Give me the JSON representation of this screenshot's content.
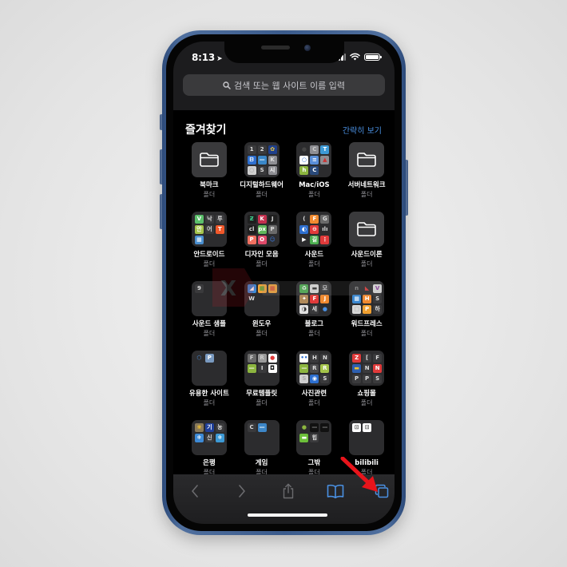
{
  "status_bar": {
    "time": "8:13",
    "location_icon": "location-arrow-icon",
    "signal_icon": "cellular-signal-icon",
    "wifi_icon": "wifi-icon",
    "battery_icon": "battery-icon",
    "battery_level": 1.0
  },
  "search": {
    "placeholder": "검색 또는 웹 사이트 이름 입력",
    "icon": "search-icon"
  },
  "favorites": {
    "title": "즐겨찾기",
    "action_label": "간략히 보기",
    "accent_color": "#4a90e2",
    "items": [
      {
        "name": "북마크",
        "sub": "폴더",
        "type": "folder"
      },
      {
        "name": "디지털하드웨어",
        "sub": "폴더",
        "type": "grid",
        "tiles": [
          {
            "t": "1",
            "bg": "#3a3a3c",
            "fg": "#ddd"
          },
          {
            "t": "2",
            "bg": "#3a3a3c",
            "fg": "#ddd"
          },
          {
            "t": "✿",
            "bg": "#1f3f8a",
            "fg": "#e9c640"
          },
          {
            "t": "ᗷ",
            "bg": "#2d6fd0",
            "fg": "#fff"
          },
          {
            "t": "—",
            "bg": "#3a87c8",
            "fg": "#fff"
          },
          {
            "t": "K",
            "bg": "#8e8e93",
            "fg": "#ddd"
          },
          {
            "t": "○",
            "bg": "#cfcfcf",
            "fg": "#999"
          },
          {
            "t": "S",
            "bg": "#3a3a3c",
            "fg": "#ddd"
          },
          {
            "t": "시",
            "bg": "#8e8e93",
            "fg": "#fff"
          }
        ]
      },
      {
        "name": "Mac/iOS",
        "sub": "폴더",
        "type": "grid",
        "tiles": [
          {
            "t": "●",
            "bg": "#2c2c2e",
            "fg": "#444"
          },
          {
            "t": "C",
            "bg": "#8e8e93",
            "fg": "#ccc"
          },
          {
            "t": "T",
            "bg": "#3d9ad6",
            "fg": "#fff"
          },
          {
            "t": "○",
            "bg": "#fff",
            "fg": "#2d6fd0"
          },
          {
            "t": "≡",
            "bg": "#5a8fd8",
            "fg": "#fff"
          },
          {
            "t": "▲",
            "bg": "#8e8e93",
            "fg": "#c33"
          },
          {
            "t": "h",
            "bg": "#8cb53f",
            "fg": "#fff"
          },
          {
            "t": "C",
            "bg": "#2a4a7a",
            "fg": "#fff"
          }
        ]
      },
      {
        "name": "서버네트워크",
        "sub": "폴더",
        "type": "folder"
      },
      {
        "name": "안드로이드",
        "sub": "폴더",
        "type": "grid",
        "tiles": [
          {
            "t": "V",
            "bg": "#5bbf6a",
            "fg": "#fff"
          },
          {
            "t": "낙",
            "bg": "#3a3a3c",
            "fg": "#ddd"
          },
          {
            "t": "루",
            "bg": "#3a3a3c",
            "fg": "#ddd"
          },
          {
            "t": "안",
            "bg": "#a4c44a",
            "fg": "#fff"
          },
          {
            "t": "어",
            "bg": "#3a3a3c",
            "fg": "#ddd"
          },
          {
            "t": "T",
            "bg": "#f0582a",
            "fg": "#fff"
          },
          {
            "t": "▦",
            "bg": "#4a8fd0",
            "fg": "#fff"
          }
        ]
      },
      {
        "name": "디자인 모음",
        "sub": "폴더",
        "type": "grid",
        "tiles": [
          {
            "t": "Ƶ",
            "bg": "#1f1f1f",
            "fg": "#3ccf8e"
          },
          {
            "t": "K",
            "bg": "#c3304e",
            "fg": "#fff"
          },
          {
            "t": "J",
            "bg": "#1f1f1f",
            "fg": "#ddd"
          },
          {
            "t": "cl",
            "bg": "#1f1f1f",
            "fg": "#ddd"
          },
          {
            "t": "px",
            "bg": "#5fb55a",
            "fg": "#fff"
          },
          {
            "t": "P",
            "bg": "#6a6a6a",
            "fg": "#ddd"
          },
          {
            "t": "P",
            "bg": "#f07060",
            "fg": "#fff"
          },
          {
            "t": "O",
            "bg": "#e04a6a",
            "fg": "#fff"
          },
          {
            "t": "☺",
            "bg": "#2c2c2e",
            "fg": "#3d7be0"
          }
        ]
      },
      {
        "name": "사운드",
        "sub": "폴더",
        "type": "grid",
        "tiles": [
          {
            "t": "(",
            "bg": "#2c2c2e",
            "fg": "#ddd"
          },
          {
            "t": "F",
            "bg": "#f08a30",
            "fg": "#fff"
          },
          {
            "t": "G",
            "bg": "#6a6a6a",
            "fg": "#ddd"
          },
          {
            "t": "◐",
            "bg": "#2d6fd0",
            "fg": "#fff"
          },
          {
            "t": "⊖",
            "bg": "#e03a3a",
            "fg": "#fff"
          },
          {
            "t": "ılı",
            "bg": "#2c2c2e",
            "fg": "#ddd"
          },
          {
            "t": "▶",
            "bg": "#2c2c2e",
            "fg": "#fff"
          },
          {
            "t": "길",
            "bg": "#4caf50",
            "fg": "#fff"
          },
          {
            "t": "⋮",
            "bg": "#e03a3a",
            "fg": "#fff"
          }
        ]
      },
      {
        "name": "사운드이론",
        "sub": "폴더",
        "type": "folder"
      },
      {
        "name": "사운드 샘플",
        "sub": "폴더",
        "type": "grid",
        "tiles": [
          {
            "t": "9",
            "bg": "#3a3a3c",
            "fg": "#ddd"
          }
        ]
      },
      {
        "name": "윈도우",
        "sub": "폴더",
        "type": "grid",
        "tiles": [
          {
            "t": "◢",
            "bg": "#3d8ad6",
            "fg": "#fff"
          },
          {
            "t": "▦",
            "bg": "#f2a33a",
            "fg": "#2d9a3a"
          },
          {
            "t": "▦",
            "bg": "#f2a33a",
            "fg": "#d03a3a"
          },
          {
            "t": "W",
            "bg": "#2c2c2e",
            "fg": "#ddd"
          }
        ]
      },
      {
        "name": "블로그",
        "sub": "폴더",
        "type": "grid",
        "tiles": [
          {
            "t": "♻",
            "bg": "#4caf50",
            "fg": "#fff"
          },
          {
            "t": "▬",
            "bg": "#e0e0e0",
            "fg": "#333"
          },
          {
            "t": "모",
            "bg": "#3a3a3c",
            "fg": "#ddd"
          },
          {
            "t": "✦",
            "bg": "#b08a5a",
            "fg": "#fff"
          },
          {
            "t": "F",
            "bg": "#e03a3a",
            "fg": "#fff"
          },
          {
            "t": "J",
            "bg": "#f08a30",
            "fg": "#fff"
          },
          {
            "t": "◑",
            "bg": "#e0e0e0",
            "fg": "#333"
          },
          {
            "t": "세",
            "bg": "#3a3a3c",
            "fg": "#ddd"
          },
          {
            "t": "●",
            "bg": "#2c2c2e",
            "fg": "#4a90e2"
          }
        ]
      },
      {
        "name": "워드프레스",
        "sub": "폴더",
        "type": "grid",
        "tiles": [
          {
            "t": "n",
            "bg": "#2c2c2e",
            "fg": "#888"
          },
          {
            "t": "◣",
            "bg": "#2c2c2e",
            "fg": "#e03a3a"
          },
          {
            "t": "V",
            "bg": "#e0e0e0",
            "fg": "#8c3aa0"
          },
          {
            "t": "▦",
            "bg": "#3a87d0",
            "fg": "#fff"
          },
          {
            "t": "H",
            "bg": "#f08a30",
            "fg": "#fff"
          },
          {
            "t": "S",
            "bg": "#3a3a3c",
            "fg": "#ddd"
          },
          {
            "t": "□",
            "bg": "#d8d8d8",
            "fg": "#aaa"
          },
          {
            "t": "P",
            "bg": "#f0a030",
            "fg": "#fff"
          },
          {
            "t": "하",
            "bg": "#3a3a3c",
            "fg": "#ddd"
          }
        ]
      },
      {
        "name": "유용한 사이트",
        "sub": "폴더",
        "type": "grid",
        "tiles": [
          {
            "t": "⬡",
            "bg": "#2c2c2e",
            "fg": "#4a90e2"
          },
          {
            "t": "P",
            "bg": "#7a9ac0",
            "fg": "#fff"
          }
        ]
      },
      {
        "name": "무료템플릿",
        "sub": "폴더",
        "type": "grid",
        "tiles": [
          {
            "t": "F",
            "bg": "#6a6a6a",
            "fg": "#ccc"
          },
          {
            "t": "R",
            "bg": "#9a9a9a",
            "fg": "#ccc"
          },
          {
            "t": "●",
            "bg": "#fff",
            "fg": "#e03a3a"
          },
          {
            "t": "—",
            "bg": "#8cb53f",
            "fg": "#fff"
          },
          {
            "t": "I",
            "bg": "#3a3a3c",
            "fg": "#ddd"
          },
          {
            "t": "◘",
            "bg": "#fff",
            "fg": "#111"
          }
        ]
      },
      {
        "name": "사진관련",
        "sub": "폴더",
        "type": "grid",
        "tiles": [
          {
            "t": "••",
            "bg": "#fff",
            "fg": "#2d6fd0"
          },
          {
            "t": "H",
            "bg": "#3a3a3c",
            "fg": "#ddd"
          },
          {
            "t": "N",
            "bg": "#3a3a3c",
            "fg": "#ddd"
          },
          {
            "t": "—",
            "bg": "#8cb53f",
            "fg": "#fff"
          },
          {
            "t": "R",
            "bg": "#4a4a4c",
            "fg": "#ddd"
          },
          {
            "t": "R",
            "bg": "#a4c44a",
            "fg": "#fff"
          },
          {
            "t": "S",
            "bg": "#cfcfcf",
            "fg": "#aaa"
          },
          {
            "t": "◉",
            "bg": "#2d6fd0",
            "fg": "#fff"
          },
          {
            "t": "S",
            "bg": "#3a3a3c",
            "fg": "#ddd"
          }
        ]
      },
      {
        "name": "쇼핑몰",
        "sub": "폴더",
        "type": "grid",
        "tiles": [
          {
            "t": "Z",
            "bg": "#e03a3a",
            "fg": "#fff"
          },
          {
            "t": "[",
            "bg": "#3a3a3c",
            "fg": "#ddd"
          },
          {
            "t": "F",
            "bg": "#3a3a3c",
            "fg": "#ddd"
          },
          {
            "t": "▬",
            "bg": "#2d5fb0",
            "fg": "#f0c030"
          },
          {
            "t": "N",
            "bg": "#3a3a3c",
            "fg": "#ddd"
          },
          {
            "t": "N",
            "bg": "#e03a3a",
            "fg": "#fff"
          },
          {
            "t": "P",
            "bg": "#3a3a3c",
            "fg": "#ddd"
          },
          {
            "t": "P",
            "bg": "#3a3a3c",
            "fg": "#ddd"
          },
          {
            "t": "S",
            "bg": "#3a3a3c",
            "fg": "#ddd"
          }
        ]
      },
      {
        "name": "은행",
        "sub": "폴더",
        "type": "grid",
        "tiles": [
          {
            "t": "❀",
            "bg": "#8a7a5a",
            "fg": "#f0c030"
          },
          {
            "t": "기",
            "bg": "#1f3f9a",
            "fg": "#fff"
          },
          {
            "t": "농",
            "bg": "#3a3a3c",
            "fg": "#ddd"
          },
          {
            "t": "❄",
            "bg": "#3d8ad6",
            "fg": "#fff"
          },
          {
            "t": "신",
            "bg": "#3a3a3c",
            "fg": "#ddd"
          },
          {
            "t": "❄",
            "bg": "#3d9ad6",
            "fg": "#fff"
          }
        ]
      },
      {
        "name": "게임",
        "sub": "폴더",
        "type": "grid",
        "tiles": [
          {
            "t": "C",
            "bg": "#3a3a3c",
            "fg": "#ddd"
          },
          {
            "t": "—",
            "bg": "#3d87c8",
            "fg": "#fff"
          }
        ]
      },
      {
        "name": "그밖",
        "sub": "폴더",
        "type": "grid",
        "tiles": [
          {
            "t": "●",
            "bg": "#2c2c2e",
            "fg": "#8cb53f"
          },
          {
            "t": "—",
            "bg": "#111",
            "fg": "#888"
          },
          {
            "t": "—",
            "bg": "#111",
            "fg": "#888"
          },
          {
            "t": "▬",
            "bg": "#6cbf3a",
            "fg": "#fff"
          },
          {
            "t": "힙",
            "bg": "#3a3a3c",
            "fg": "#ddd"
          }
        ]
      },
      {
        "name": "bilibili",
        "sub": "폴더",
        "type": "grid",
        "tiles": [
          {
            "t": "⊡",
            "bg": "#fff",
            "fg": "#555"
          },
          {
            "t": "⊡",
            "bg": "#fff",
            "fg": "#555"
          }
        ]
      }
    ]
  },
  "toolbar": {
    "back_icon": "back-chevron-icon",
    "forward_icon": "forward-chevron-icon",
    "share_icon": "share-icon",
    "bookmarks_icon": "bookmarks-book-icon",
    "tabs_icon": "tabs-icon",
    "active_color": "#4a90e2",
    "disabled_color": "#6b6b6e"
  },
  "annotation": {
    "arrow_color": "#e8141b",
    "points_to": "tabs-button"
  }
}
